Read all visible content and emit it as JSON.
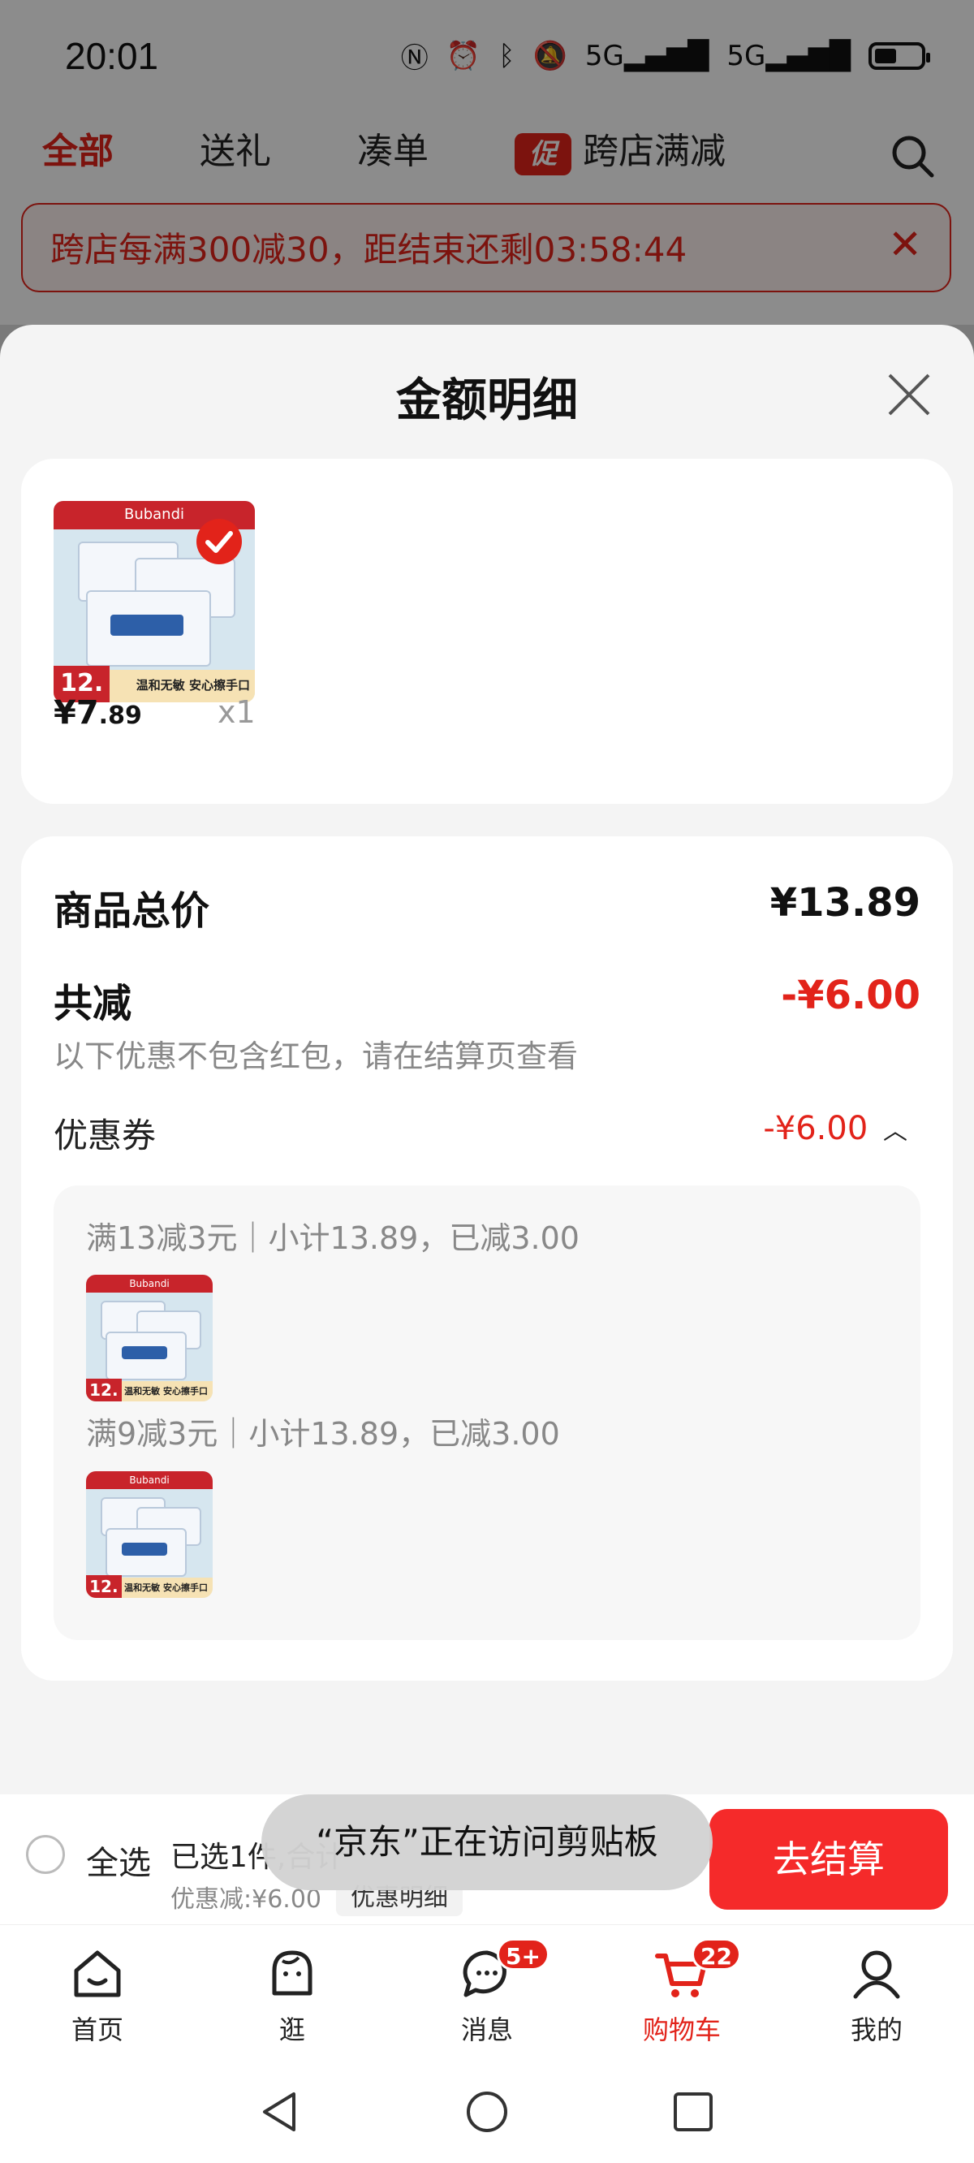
{
  "status_bar": {
    "time": "20:01",
    "signal_1": "5G",
    "signal_2": "5G"
  },
  "top_tabs": [
    {
      "label": "全部"
    },
    {
      "label": "送礼"
    },
    {
      "label": "凑单"
    },
    {
      "badge": "促",
      "label": "跨店满减"
    }
  ],
  "banner": {
    "text": "跨店每满300减30，距结束还剩03:58:44"
  },
  "sheet": {
    "title": "金额明细",
    "product": {
      "price_int": "¥7",
      "price_dec": ".89",
      "qty": "x1",
      "thumb_num": "12."
    },
    "summary": {
      "total_label": "商品总价",
      "total_value": "¥13.89",
      "discount_label": "共减",
      "discount_value": "-¥6.00",
      "note": "以下优惠不包含红包，请在结算页查看",
      "coupon_label": "优惠券",
      "coupon_value": "-¥6.00",
      "coupons": [
        {
          "text": "满13减3元｜小计13.89，已减3.00"
        },
        {
          "text": "满9减3元｜小计13.89，已减3.00"
        }
      ]
    }
  },
  "bottom_bar": {
    "select_all": "全选",
    "selected": "已选1件,合计",
    "discount": "优惠减:¥6.00",
    "detail": "优惠明细",
    "checkout": "去结算"
  },
  "toast": "“京东”正在访问剪贴板",
  "tab_bar": [
    {
      "label": "首页",
      "icon": "home-icon"
    },
    {
      "label": "逛",
      "icon": "discover-icon"
    },
    {
      "label": "消息",
      "icon": "message-icon",
      "badge": "5+"
    },
    {
      "label": "购物车",
      "icon": "cart-icon",
      "badge": "22"
    },
    {
      "label": "我的",
      "icon": "profile-icon"
    }
  ],
  "colors": {
    "accent": "#e2231a",
    "checkout": "#f52a2a"
  }
}
